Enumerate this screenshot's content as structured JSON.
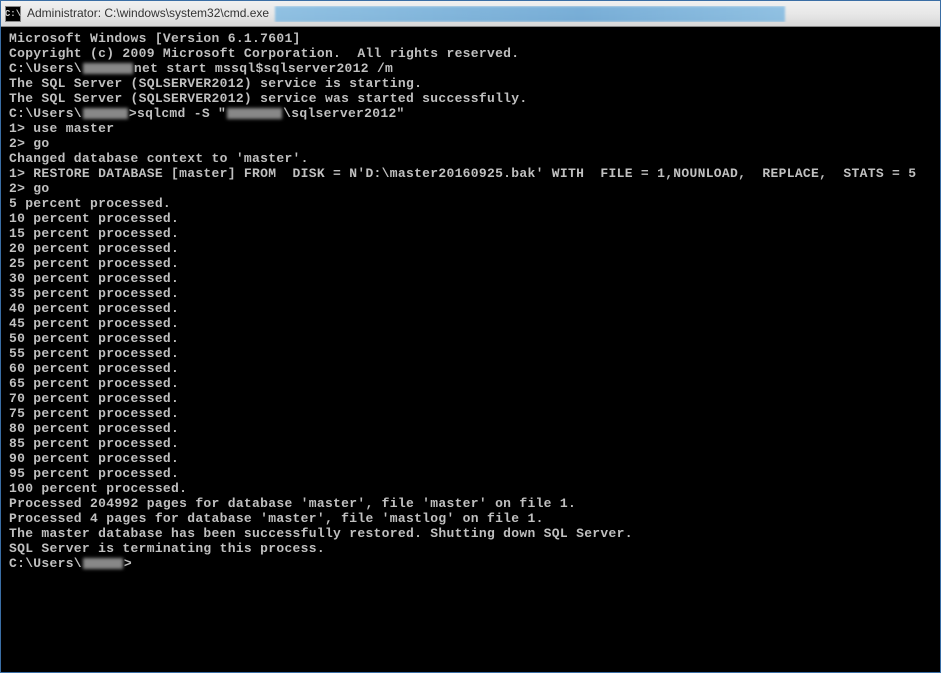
{
  "titlebar": {
    "icon_label": "C:\\",
    "title": "Administrator: C:\\windows\\system32\\cmd.exe"
  },
  "lines": {
    "l0": "Microsoft Windows [Version 6.1.7601]",
    "l1": "Copyright (c) 2009 Microsoft Corporation.  All rights reserved.",
    "l2": "",
    "l3a": "C:\\Users\\",
    "l3b": "net start mssql$sqlserver2012 /m",
    "l4": "The SQL Server (SQLSERVER2012) service is starting.",
    "l5": "The SQL Server (SQLSERVER2012) service was started successfully.",
    "l6": "",
    "l7": "",
    "l8a": "C:\\Users\\",
    "l8b": ">sqlcmd -S \"",
    "l8c": "\\sqlserver2012\"",
    "l9": "1> use master",
    "l10": "2> go",
    "l11": "Changed database context to 'master'.",
    "l12": "1> RESTORE DATABASE [master] FROM  DISK = N'D:\\master20160925.bak' WITH  FILE = 1,NOUNLOAD,  REPLACE,  STATS = 5",
    "l13": "2> go",
    "l14": "5 percent processed.",
    "l15": "10 percent processed.",
    "l16": "15 percent processed.",
    "l17": "20 percent processed.",
    "l18": "25 percent processed.",
    "l19": "30 percent processed.",
    "l20": "35 percent processed.",
    "l21": "40 percent processed.",
    "l22": "45 percent processed.",
    "l23": "50 percent processed.",
    "l24": "55 percent processed.",
    "l25": "60 percent processed.",
    "l26": "65 percent processed.",
    "l27": "70 percent processed.",
    "l28": "75 percent processed.",
    "l29": "80 percent processed.",
    "l30": "85 percent processed.",
    "l31": "90 percent processed.",
    "l32": "95 percent processed.",
    "l33": "100 percent processed.",
    "l34": "Processed 204992 pages for database 'master', file 'master' on file 1.",
    "l35": "Processed 4 pages for database 'master', file 'mastlog' on file 1.",
    "l36": "The master database has been successfully restored. Shutting down SQL Server.",
    "l37": "SQL Server is terminating this process.",
    "l38": "",
    "l39a": "C:\\Users\\",
    "l39b": ">"
  }
}
